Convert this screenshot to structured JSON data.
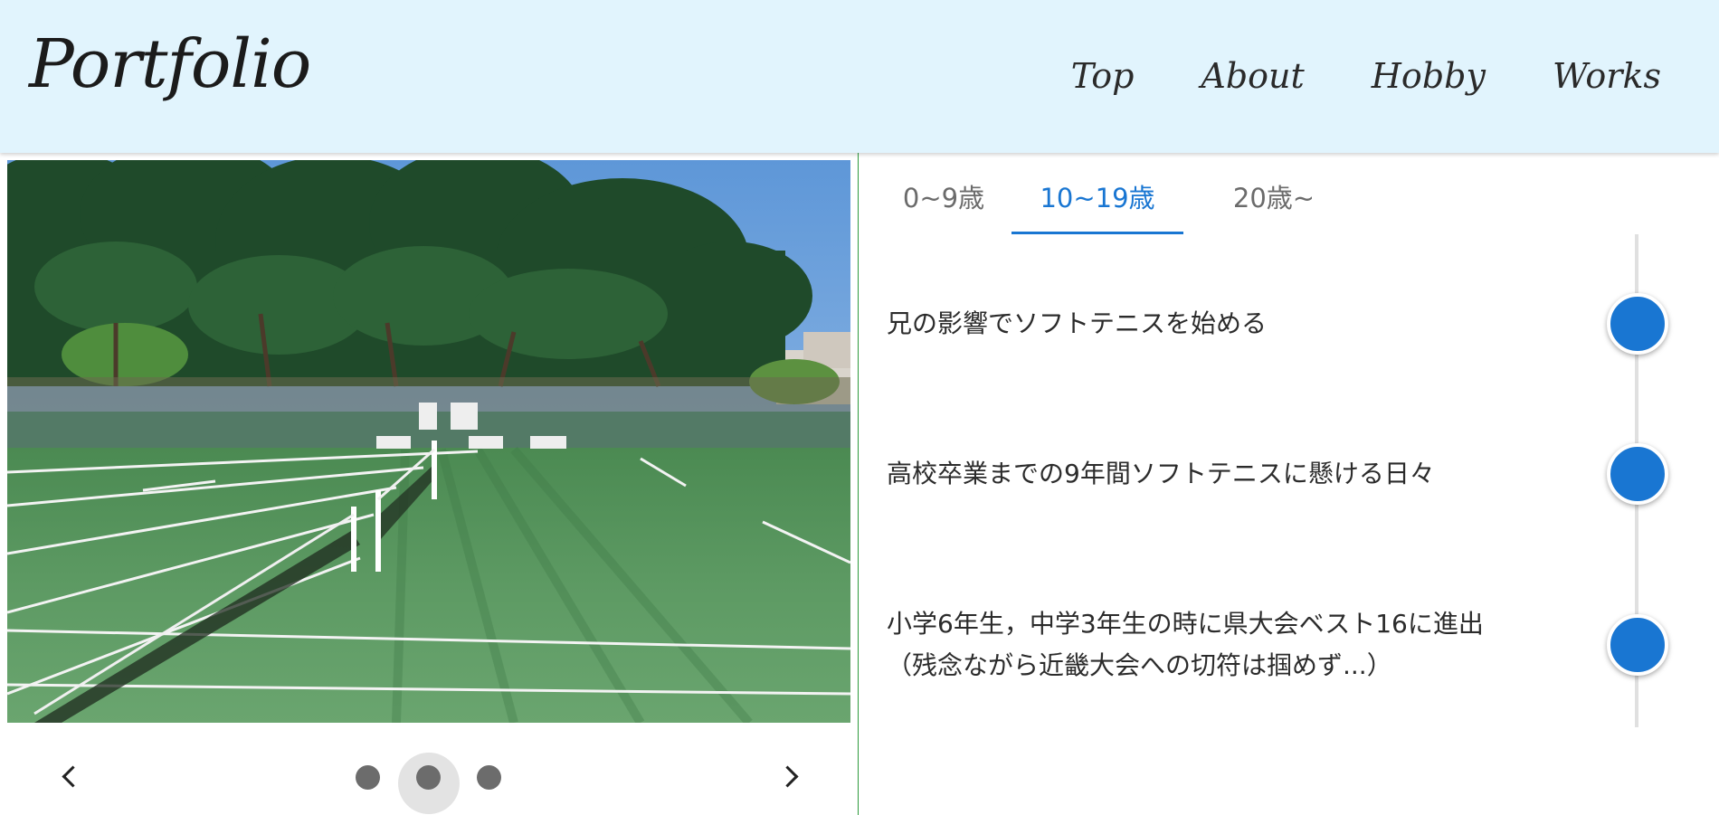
{
  "header": {
    "logo": "Portfolio",
    "nav": [
      "Top",
      "About",
      "Hobby",
      "Works"
    ],
    "background": "#e1f4fd"
  },
  "carousel": {
    "image_description_icon": "tennis-court-photo",
    "prev_icon": "chevron-left-icon",
    "next_icon": "chevron-right-icon",
    "slide_count": 3,
    "active_slide": 2
  },
  "tabs": {
    "items": [
      "0~9歳",
      "10~19歳",
      "20歳~"
    ],
    "active_index": 1,
    "accent": "#1976d2"
  },
  "timeline": {
    "events": [
      {
        "line1": "兄の影響でソフトテニスを始める",
        "line2": ""
      },
      {
        "line1": "高校卒業までの9年間ソフトテニスに懸ける日々",
        "line2": ""
      },
      {
        "line1": "小学6年生，中学3年生の時に県大会ベスト16に進出",
        "line2": "（残念ながら近畿大会への切符は掴めず...）"
      }
    ],
    "dot_color": "#1976d2"
  }
}
